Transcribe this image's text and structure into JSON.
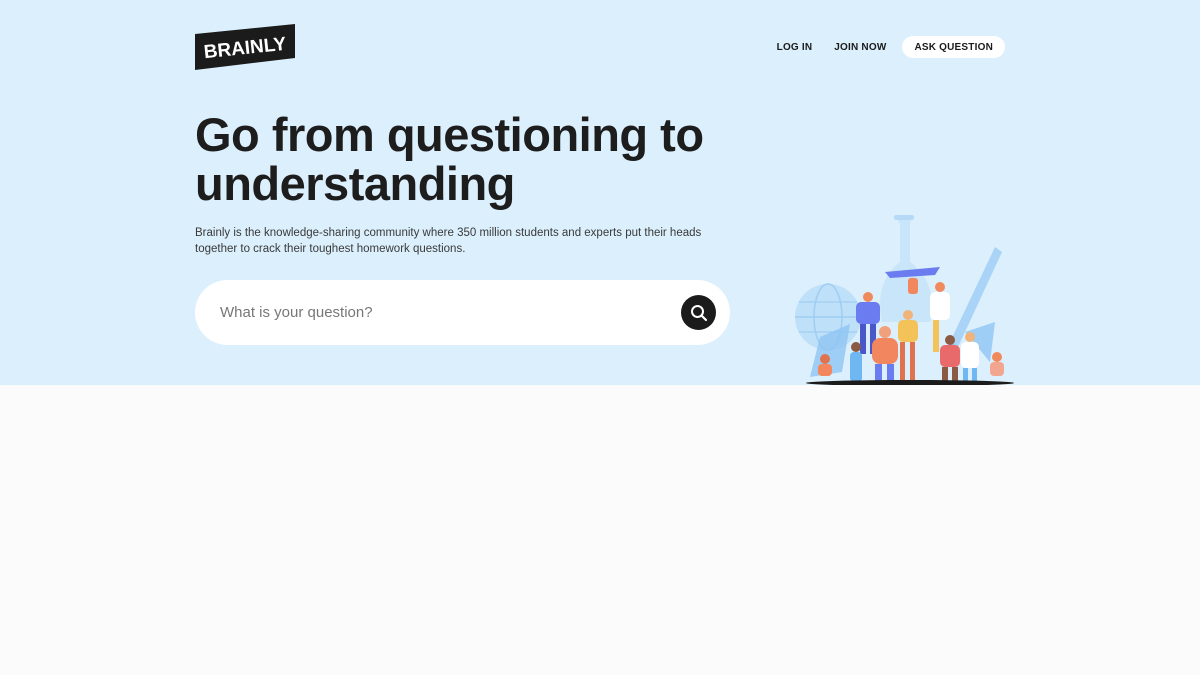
{
  "brand": {
    "logo_text": "BRAINLY",
    "colors": {
      "hero_bg": "#dbeffc",
      "page_bg": "#fbfbfb",
      "text_dark": "#1d1d1d",
      "button_bg": "#ffffff",
      "search_button": "#1b1b1b"
    }
  },
  "nav": {
    "login_label": "LOG IN",
    "join_label": "JOIN NOW",
    "ask_label": "ASK QUESTION"
  },
  "hero": {
    "headline": "Go from questioning to understanding",
    "description": "Brainly is the knowledge-sharing community where 350 million students and experts put their heads together to crack their toughest homework questions."
  },
  "search": {
    "placeholder": "What is your question?",
    "value": "",
    "button_icon": "search-icon"
  },
  "illustration": {
    "icon": "students-community-illustration"
  }
}
